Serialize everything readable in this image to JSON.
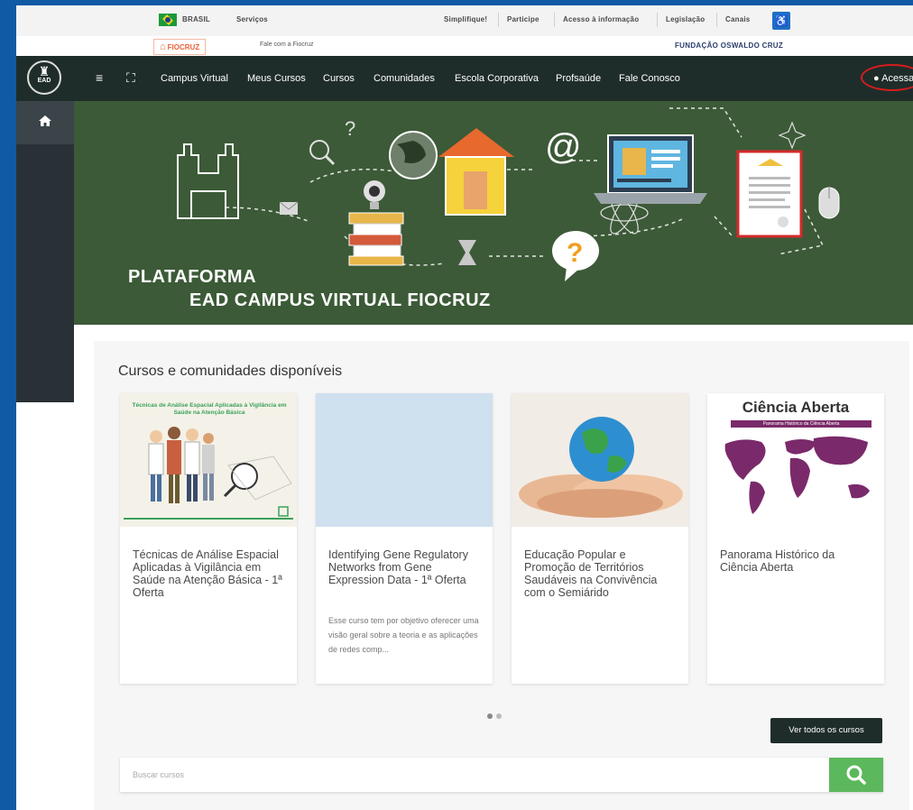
{
  "gov_bar": {
    "brasil": "BRASIL",
    "services": "Serviços",
    "links": [
      "Simplifique!",
      "Participe",
      "Acesso à informação",
      "Legislação",
      "Canais"
    ]
  },
  "fiocruz_bar": {
    "logo": "FIOCRUZ",
    "fale": "Fale com a Fiocruz",
    "foundation": "FUNDAÇÃO OSWALDO CRUZ"
  },
  "navbar": {
    "logo_text": "EAD",
    "links": [
      "Campus Virtual",
      "Meus Cursos",
      "Cursos",
      "Comunidades",
      "Escola Corporativa",
      "Profsaúde",
      "Fale Conosco"
    ],
    "login": "Acessar"
  },
  "banner": {
    "line1": "PLATAFORMA",
    "line2": "EAD CAMPUS VIRTUAL FIOCRUZ"
  },
  "courses": {
    "section_title": "Cursos e comunidades disponíveis",
    "cards": [
      {
        "title": "Técnicas de Análise Espacial Aplicadas à Vigilância em Saúde na Atenção Básica - 1ª Oferta",
        "image_caption": "Técnicas de Análise Espacial Aplicadas à Vigilância em Saúde na Atenção Básica",
        "description": ""
      },
      {
        "title": "Identifying Gene Regulatory Networks from Gene Expression Data - 1ª Oferta",
        "image_caption": "",
        "description": "Esse curso tem por objetivo oferecer uma visão geral sobre a teoria e as aplicações de redes comp..."
      },
      {
        "title": "Educação Popular e Promoção de Territórios Saudáveis na Convivência com o Semiárido",
        "image_caption": "",
        "description": ""
      },
      {
        "title": "Panorama Histórico da Ciência Aberta",
        "image_caption": "Ciência Aberta",
        "image_subcaption": "Panorama Histórico da Ciência Aberta",
        "description": ""
      }
    ],
    "view_all": "Ver todos os cursos",
    "search_placeholder": "Buscar cursos"
  },
  "colors": {
    "navbar": "#1f2d2a",
    "banner": "#3c5a37",
    "search_button": "#5cb85c",
    "login_highlight": "#d51d1d"
  }
}
